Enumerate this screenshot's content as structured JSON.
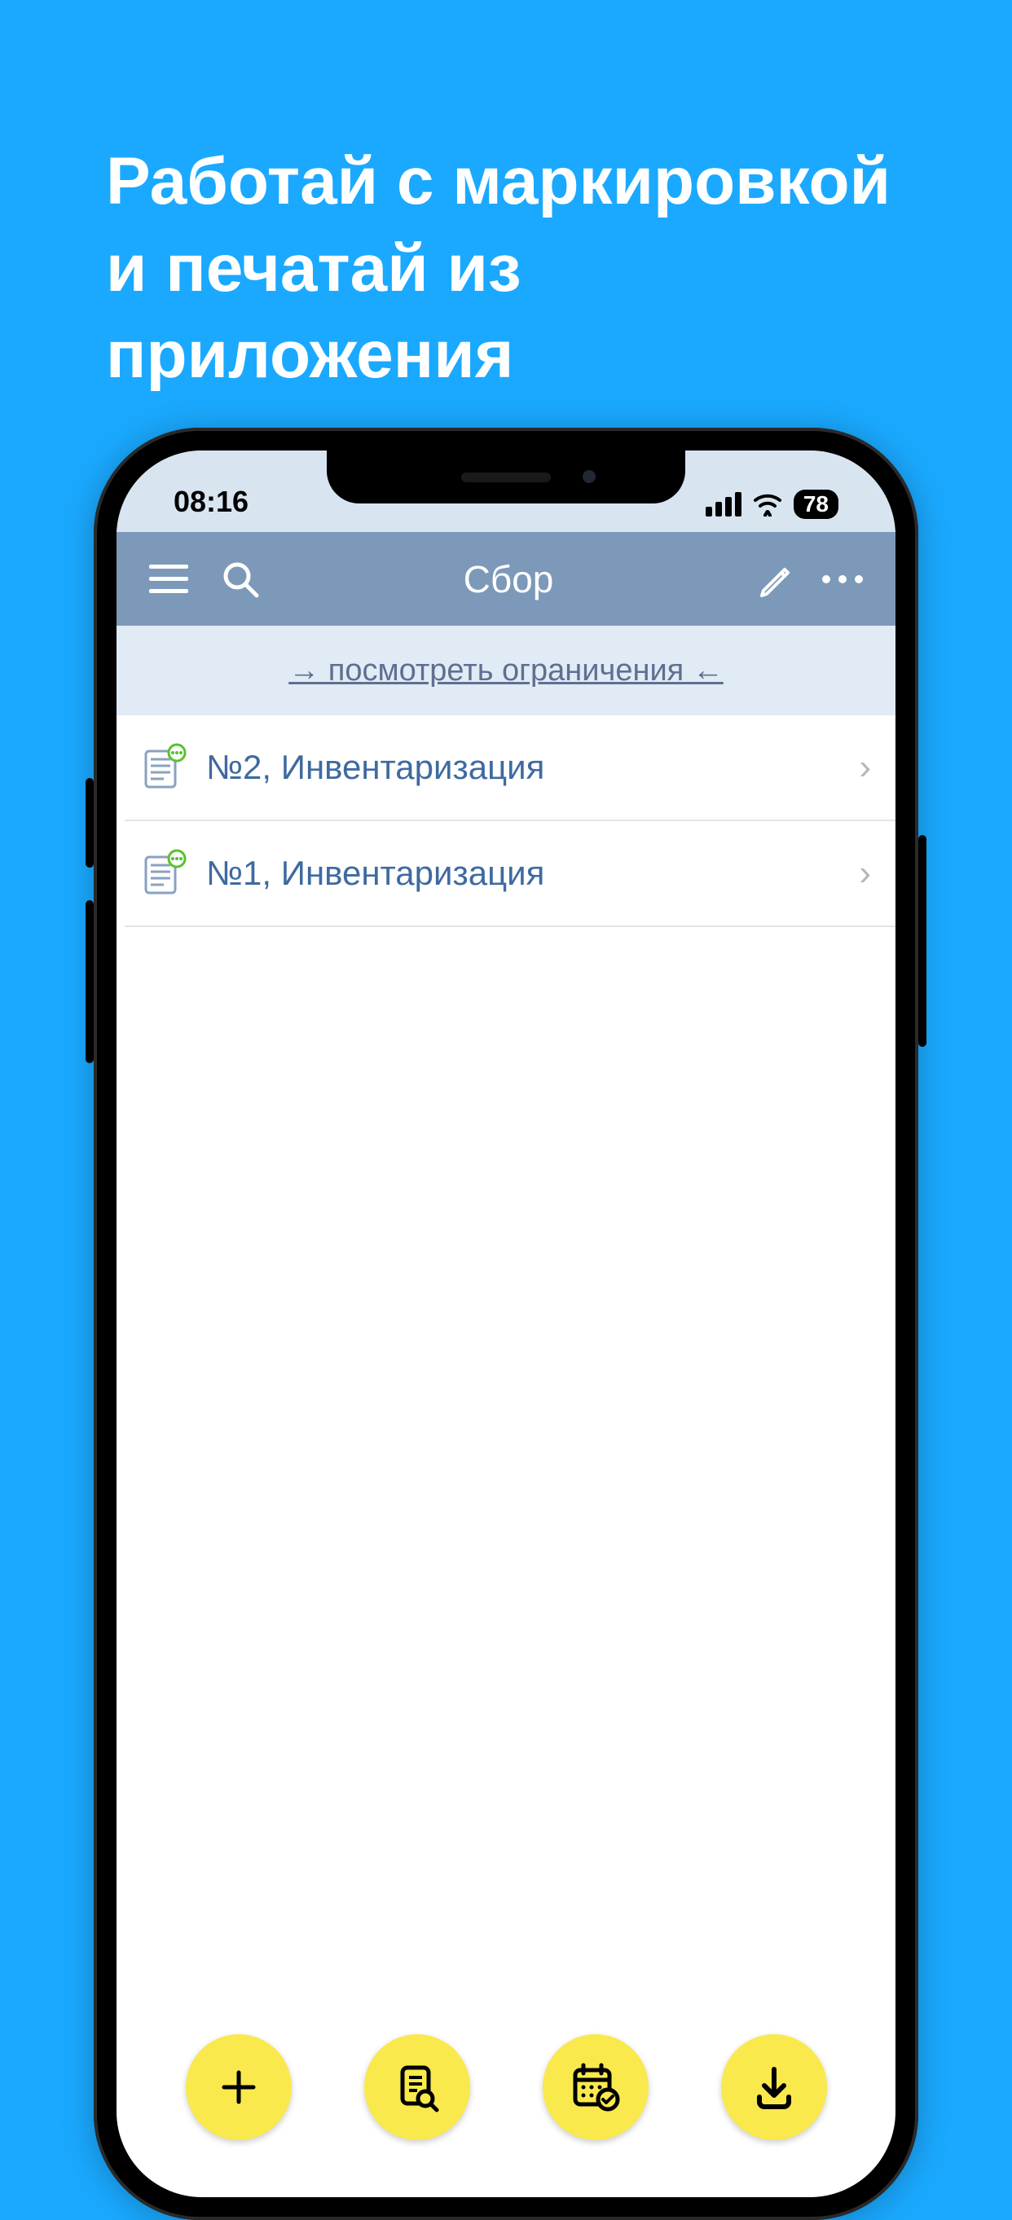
{
  "promo": {
    "headline": "Работай с маркировкой и печатай из приложения"
  },
  "status": {
    "time": "08:16",
    "battery": "78"
  },
  "nav": {
    "title": "Сбор"
  },
  "banner": {
    "text": "→ посмотреть ограничения ←"
  },
  "list": {
    "items": [
      {
        "title": "№2, Инвентаризация"
      },
      {
        "title": "№1, Инвентаризация"
      }
    ]
  }
}
